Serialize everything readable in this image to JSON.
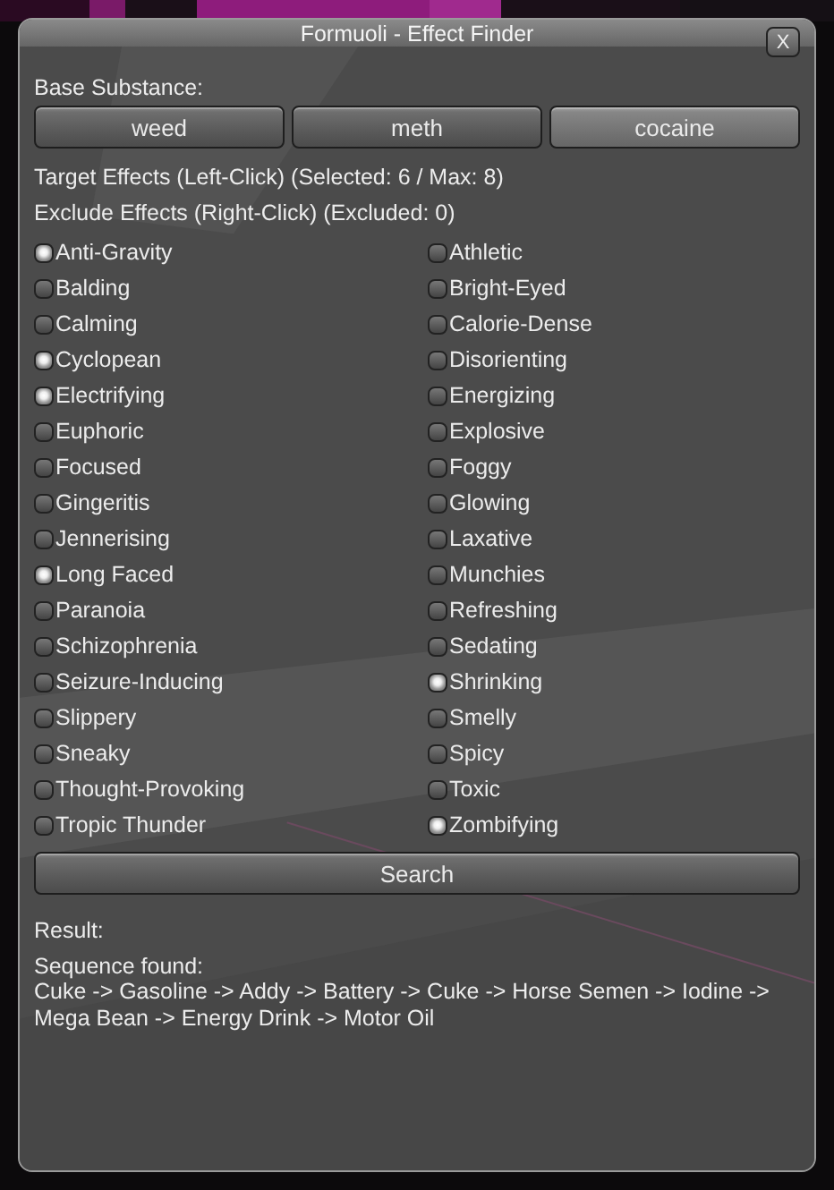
{
  "window": {
    "title": "Formuoli - Effect Finder",
    "close_label": "X"
  },
  "base_substance": {
    "label": "Base Substance:",
    "options": [
      {
        "label": "weed",
        "selected": false
      },
      {
        "label": "meth",
        "selected": false
      },
      {
        "label": "cocaine",
        "selected": true
      }
    ]
  },
  "target_info": "Target Effects (Left-Click) (Selected: 6 / Max: 8)",
  "exclude_info": "Exclude Effects (Right-Click) (Excluded: 0)",
  "effect_columns": [
    {
      "effects": [
        {
          "label": "Anti-Gravity",
          "checked": true
        },
        {
          "label": "Balding",
          "checked": false
        },
        {
          "label": "Calming",
          "checked": false
        },
        {
          "label": "Cyclopean",
          "checked": true
        },
        {
          "label": "Electrifying",
          "checked": true
        },
        {
          "label": "Euphoric",
          "checked": false
        },
        {
          "label": "Focused",
          "checked": false
        },
        {
          "label": "Gingeritis",
          "checked": false
        },
        {
          "label": "Jennerising",
          "checked": false
        },
        {
          "label": "Long Faced",
          "checked": true
        },
        {
          "label": "Paranoia",
          "checked": false
        },
        {
          "label": "Schizophrenia",
          "checked": false
        },
        {
          "label": "Seizure-Inducing",
          "checked": false
        },
        {
          "label": "Slippery",
          "checked": false
        },
        {
          "label": "Sneaky",
          "checked": false
        },
        {
          "label": "Thought-Provoking",
          "checked": false
        },
        {
          "label": "Tropic Thunder",
          "checked": false
        }
      ]
    },
    {
      "effects": [
        {
          "label": "Athletic",
          "checked": false
        },
        {
          "label": "Bright-Eyed",
          "checked": false
        },
        {
          "label": "Calorie-Dense",
          "checked": false
        },
        {
          "label": "Disorienting",
          "checked": false
        },
        {
          "label": "Energizing",
          "checked": false
        },
        {
          "label": "Explosive",
          "checked": false
        },
        {
          "label": "Foggy",
          "checked": false
        },
        {
          "label": "Glowing",
          "checked": false
        },
        {
          "label": "Laxative",
          "checked": false
        },
        {
          "label": "Munchies",
          "checked": false
        },
        {
          "label": "Refreshing",
          "checked": false
        },
        {
          "label": "Sedating",
          "checked": false
        },
        {
          "label": "Shrinking",
          "checked": true
        },
        {
          "label": "Smelly",
          "checked": false
        },
        {
          "label": "Spicy",
          "checked": false
        },
        {
          "label": "Toxic",
          "checked": false
        },
        {
          "label": "Zombifying",
          "checked": true
        }
      ]
    }
  ],
  "search_button": "Search",
  "result": {
    "label": "Result:",
    "heading": "Sequence found:",
    "sequence": "Cuke -> Gasoline -> Addy -> Battery -> Cuke -> Horse Semen -> Iodine -> Mega Bean -> Energy Drink -> Motor Oil"
  }
}
